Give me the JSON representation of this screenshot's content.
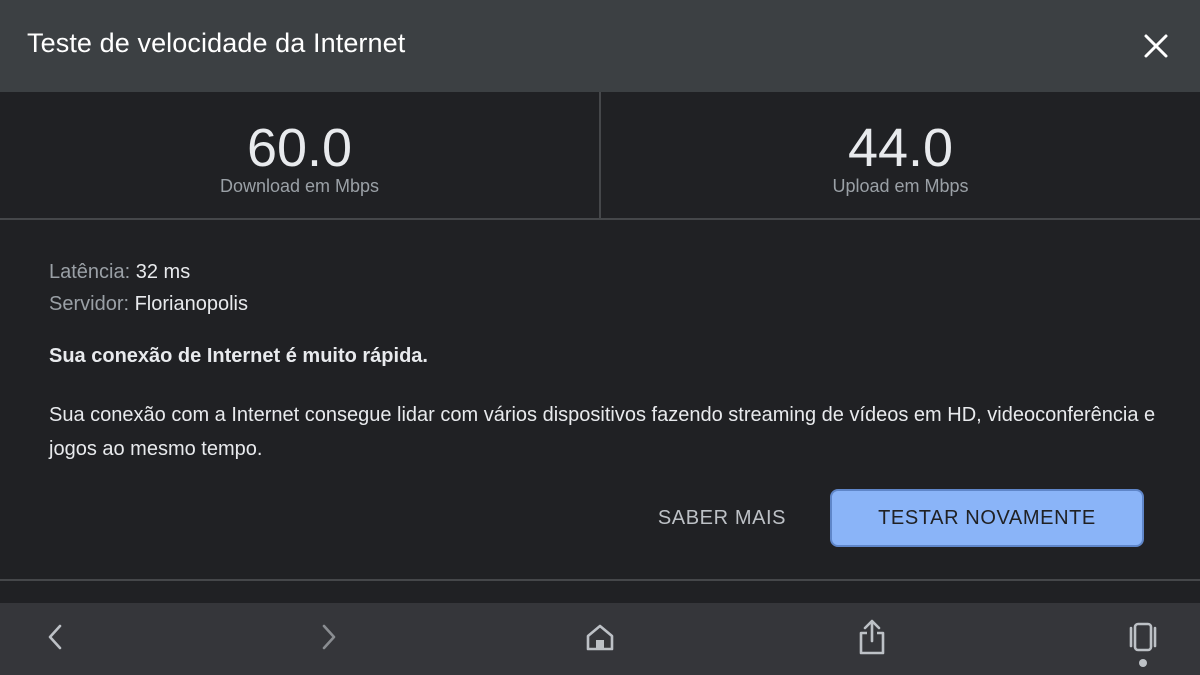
{
  "header": {
    "title": "Teste de velocidade da Internet",
    "close_icon": "close-icon"
  },
  "stats": {
    "download": {
      "value": "60.0",
      "unit": "Download em Mbps"
    },
    "upload": {
      "value": "44.0",
      "unit": "Upload em Mbps"
    }
  },
  "details": {
    "latency_label": "Latência:",
    "latency_value": "32 ms",
    "server_label": "Servidor:",
    "server_value": "Florianopolis"
  },
  "result": {
    "headline": "Sua conexão de Internet é muito rápida.",
    "description": "Sua conexão com a Internet consegue lidar com vários dispositivos fazendo streaming de vídeos em HD, videoconferência e jogos ao mesmo tempo."
  },
  "actions": {
    "learn_more": "SABER MAIS",
    "test_again": "TESTAR NOVAMENTE"
  },
  "toolbar": {
    "icons": [
      "chevron-left-icon",
      "chevron-right-icon",
      "home-icon",
      "share-icon",
      "tabs-icon"
    ]
  },
  "colors": {
    "header_bg": "#3c4043",
    "body_bg": "#202124",
    "toolbar_bg": "#35363a",
    "accent": "#8ab4f8"
  }
}
